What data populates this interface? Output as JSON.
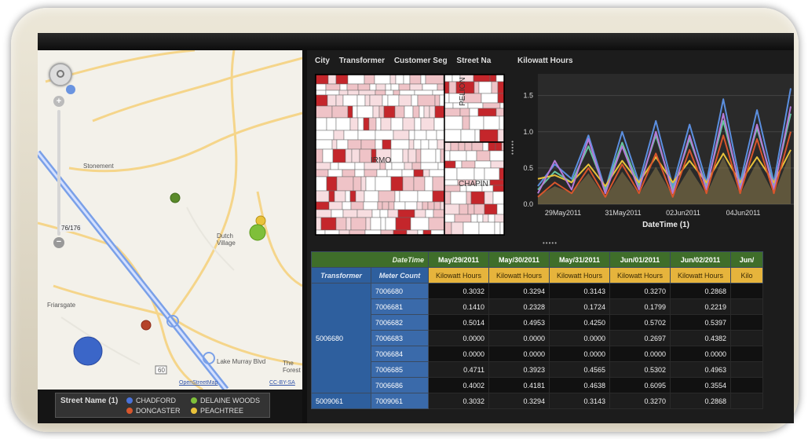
{
  "map": {
    "zoom_level": "76/176",
    "places": [
      "Stonement",
      "Dutch Village",
      "Friarsgate",
      "Lake Murray Blvd",
      "The Forest",
      "60"
    ],
    "attribution_left": "OpenStreetMap",
    "attribution_right": "CC-BY-SA"
  },
  "legend": {
    "title": "Street Name (1)",
    "items": [
      {
        "label": "CHADFORD",
        "color": "#4a72d8"
      },
      {
        "label": "DELAINE WOODS",
        "color": "#7fbf3a"
      },
      {
        "label": "DONCASTER",
        "color": "#d8562c"
      },
      {
        "label": "PEACHTREE",
        "color": "#e9c23a"
      }
    ]
  },
  "treemap": {
    "headers": [
      "City",
      "Transformer",
      "Customer Seg",
      "Street Na"
    ],
    "labels": [
      "PELION",
      "IRMO",
      "CHAPIN"
    ]
  },
  "linechart": {
    "title": "Kilowatt Hours",
    "axis_title": "DateTime (1)"
  },
  "chart_data": {
    "type": "line",
    "title": "Kilowatt Hours",
    "xlabel": "DateTime (1)",
    "ylabel": "",
    "ylim": [
      0,
      1.8
    ],
    "yticks": [
      0.0,
      0.5,
      1.0,
      1.5
    ],
    "xticks": [
      "29May2011",
      "31May2011",
      "02Jun2011",
      "04Jun2011"
    ],
    "x": [
      0,
      0.5,
      1,
      1.5,
      2,
      2.5,
      3,
      3.5,
      4,
      4.5,
      5,
      5.5,
      6,
      6.5,
      7,
      7.5
    ],
    "series": [
      {
        "color": "#5b8fe0",
        "values": [
          0.25,
          0.55,
          0.35,
          0.95,
          0.2,
          1.0,
          0.3,
          1.15,
          0.25,
          1.1,
          0.3,
          1.45,
          0.3,
          1.3,
          0.3,
          1.6
        ]
      },
      {
        "color": "#66c6a0",
        "values": [
          0.2,
          0.45,
          0.3,
          0.8,
          0.2,
          0.85,
          0.25,
          0.95,
          0.2,
          0.9,
          0.25,
          1.15,
          0.25,
          1.05,
          0.25,
          1.25
        ]
      },
      {
        "color": "#e9c23a",
        "values": [
          0.35,
          0.4,
          0.3,
          0.55,
          0.25,
          0.6,
          0.3,
          0.65,
          0.3,
          0.6,
          0.3,
          0.7,
          0.3,
          0.65,
          0.3,
          0.75
        ]
      },
      {
        "color": "#b57ad8",
        "values": [
          0.15,
          0.6,
          0.2,
          0.9,
          0.15,
          0.8,
          0.2,
          1.0,
          0.15,
          0.95,
          0.2,
          1.25,
          0.2,
          1.1,
          0.2,
          1.35
        ]
      },
      {
        "color": "#d8562c",
        "values": [
          0.1,
          0.3,
          0.15,
          0.5,
          0.1,
          0.55,
          0.15,
          0.7,
          0.1,
          0.75,
          0.15,
          0.95,
          0.15,
          0.9,
          0.15,
          1.0
        ]
      }
    ]
  },
  "table": {
    "row_header_label": "DateTime",
    "col_headers": [
      "Transformer",
      "Meter Count"
    ],
    "dates": [
      "May/29/2011",
      "May/30/2011",
      "May/31/2011",
      "Jun/01/2011",
      "Jun/02/2011",
      "Jun/"
    ],
    "measure": [
      "Kilowatt Hours",
      "Kilowatt Hours",
      "Kilowatt Hours",
      "Kilowatt Hours",
      "Kilowatt Hours",
      "Kilo"
    ],
    "groups": [
      {
        "transformer": "5006680",
        "rows": [
          {
            "meter": "7006680",
            "values": [
              "0.3032",
              "0.3294",
              "0.3143",
              "0.3270",
              "0.2868"
            ]
          },
          {
            "meter": "7006681",
            "values": [
              "0.1410",
              "0.2328",
              "0.1724",
              "0.1799",
              "0.2219"
            ]
          },
          {
            "meter": "7006682",
            "values": [
              "0.5014",
              "0.4953",
              "0.4250",
              "0.5702",
              "0.5397"
            ]
          },
          {
            "meter": "7006683",
            "values": [
              "0.0000",
              "0.0000",
              "0.0000",
              "0.2697",
              "0.4382"
            ]
          },
          {
            "meter": "7006684",
            "values": [
              "0.0000",
              "0.0000",
              "0.0000",
              "0.0000",
              "0.0000"
            ]
          },
          {
            "meter": "7006685",
            "values": [
              "0.4711",
              "0.3923",
              "0.4565",
              "0.5302",
              "0.4963"
            ]
          },
          {
            "meter": "7006686",
            "values": [
              "0.4002",
              "0.4181",
              "0.4638",
              "0.6095",
              "0.3554"
            ]
          }
        ]
      },
      {
        "transformer": "5009061",
        "rows": [
          {
            "meter": "7009061",
            "values": [
              "0.3032",
              "0.3294",
              "0.3143",
              "0.3270",
              "0.2868"
            ]
          }
        ]
      }
    ]
  }
}
